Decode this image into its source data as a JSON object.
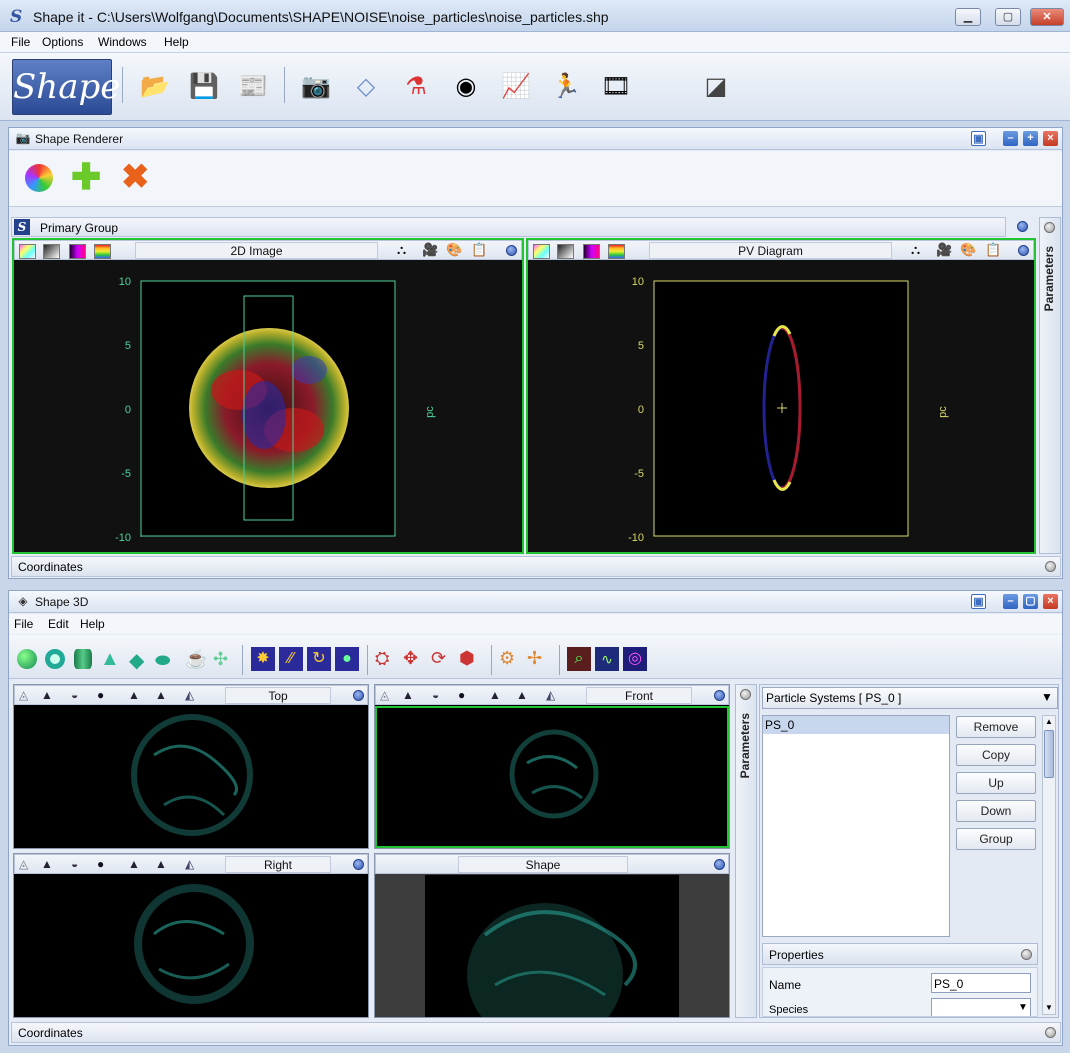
{
  "window": {
    "title": "Shape it - C:\\Users\\Wolfgang\\Documents\\SHAPE\\NOISE\\noise_particles\\noise_particles.shp",
    "app_icon_letter": "S"
  },
  "menubar": [
    "File",
    "Options",
    "Windows",
    "Help"
  ],
  "logo_text": "Shape",
  "renderer": {
    "title": "Shape Renderer",
    "group_title": "Primary Group",
    "parameters_tab": "Parameters",
    "coordinates_label": "Coordinates",
    "left_view": {
      "label": "2D Image",
      "y_ticks": [
        "10",
        "5",
        "0",
        "-5",
        "-10"
      ],
      "axis_unit": "pc"
    },
    "right_view": {
      "label": "PV Diagram",
      "y_ticks": [
        "10",
        "5",
        "0",
        "-5",
        "-10"
      ],
      "axis_unit": "pc"
    }
  },
  "shape3d": {
    "title": "Shape 3D",
    "menu": [
      "File",
      "Edit",
      "Help"
    ],
    "views": {
      "top": "Top",
      "front": "Front",
      "right": "Right",
      "shape": "Shape"
    },
    "parameters_tab": "Parameters",
    "particle_systems_select": "Particle Systems [ PS_0 ]",
    "list_items": [
      "PS_0"
    ],
    "buttons": {
      "remove": "Remove",
      "copy": "Copy",
      "up": "Up",
      "down": "Down",
      "group": "Group"
    },
    "properties": {
      "header": "Properties",
      "name_label": "Name",
      "name_value": "PS_0",
      "species_label": "Species"
    },
    "coordinates_label": "Coordinates"
  },
  "colors": {
    "plot_border_left": "#4fd29a",
    "plot_border_right": "#d9d96a",
    "active_view_border": "#22c233",
    "nebula_teal": "#2aa99a"
  }
}
